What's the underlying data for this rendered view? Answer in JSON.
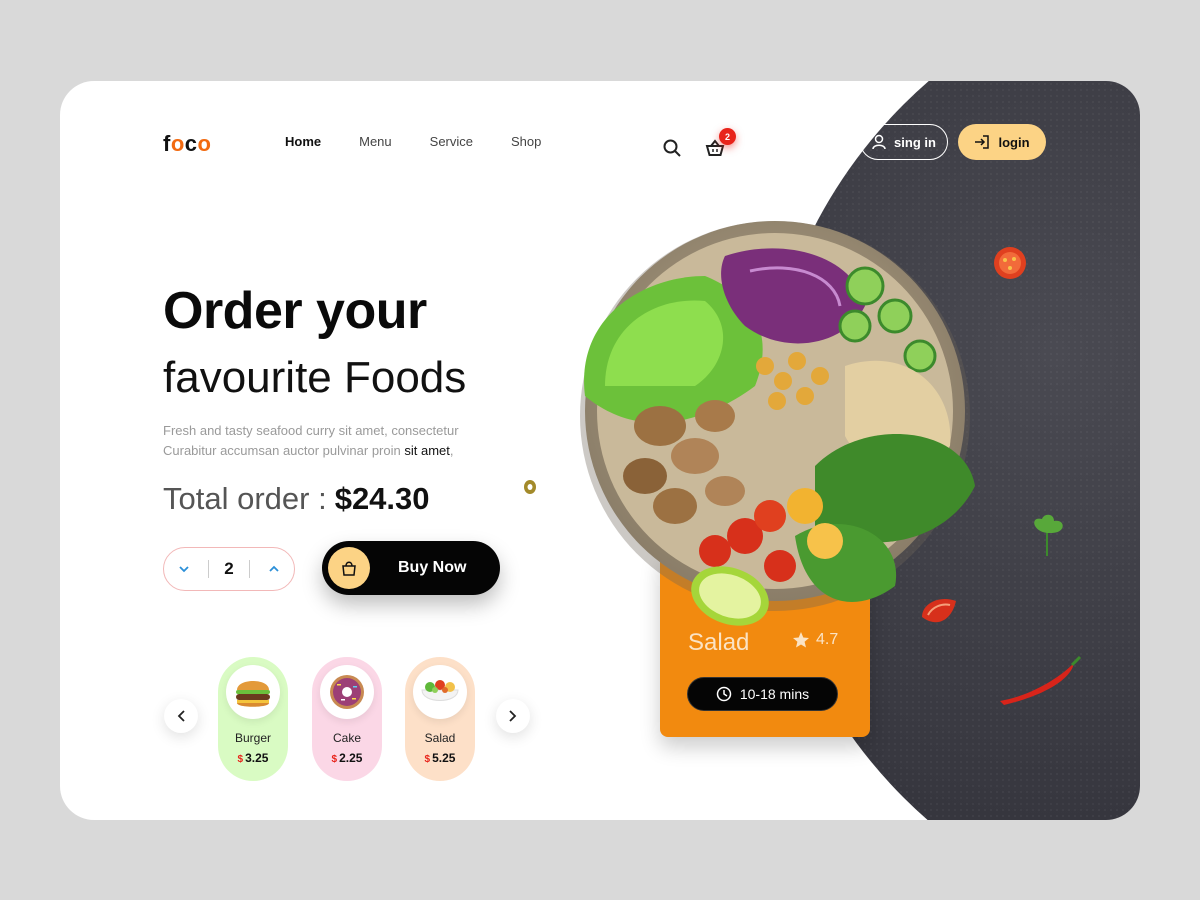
{
  "brand": {
    "logo_dark": "f",
    "logo_orange_1": "o",
    "logo_dark_2": "c",
    "logo_orange_2": "o"
  },
  "nav": {
    "items": [
      "Home",
      "Menu",
      "Service",
      "Shop"
    ],
    "active": "Home"
  },
  "header": {
    "cart_count": "2",
    "signin_label": "sing in",
    "login_label": "login"
  },
  "hero": {
    "title_line1": "Order your",
    "title_line2": "favourite Foods",
    "description_line1": "Fresh and tasty seafood curry sit amet, consectetur",
    "description_line2_plain": "Curabitur accumsan auctor pulvinar proin",
    "description_line2_highlight": "sit amet",
    "description_line2_end": ",",
    "total_label": "Total order :",
    "total_amount": "$24.30"
  },
  "order": {
    "quantity": "2",
    "buy_label": "Buy Now"
  },
  "carousel": {
    "items": [
      {
        "name": "Burger",
        "currency": "$",
        "price": "3.25",
        "icon": "burger-icon"
      },
      {
        "name": "Cake",
        "currency": "$",
        "price": "2.25",
        "icon": "donut-icon"
      },
      {
        "name": "Salad",
        "currency": "$",
        "price": "5.25",
        "icon": "salad-icon"
      }
    ]
  },
  "product": {
    "name": "Salad",
    "rating": "4.7",
    "time": "10-18 mins"
  },
  "colors": {
    "accent_yellow": "#fcd385",
    "accent_orange": "#f28a0f",
    "badge_red": "#e8241b",
    "dark": "#35353d"
  }
}
